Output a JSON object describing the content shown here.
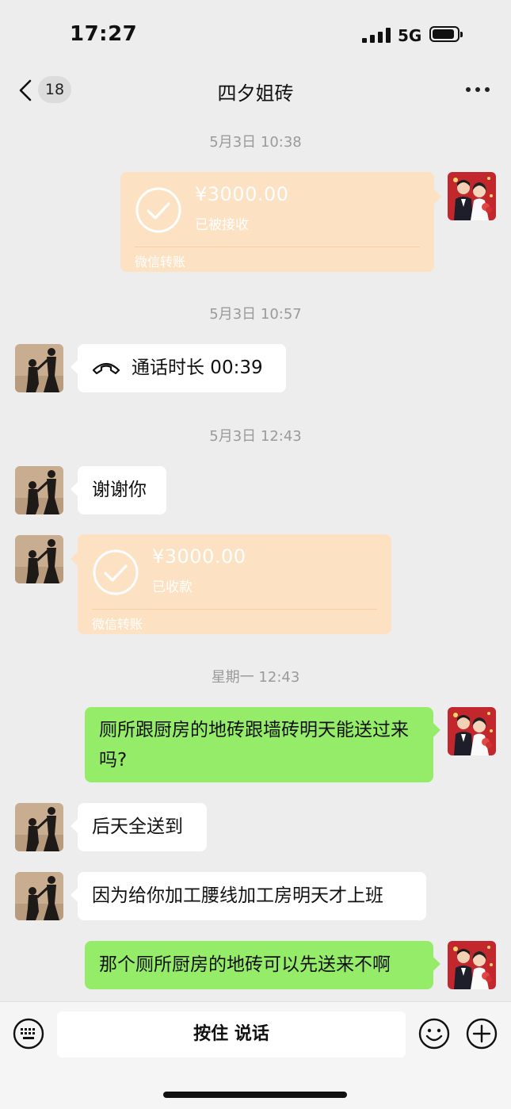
{
  "status_bar": {
    "time": "17:27",
    "network": "5G"
  },
  "nav": {
    "back_badge": "18",
    "title": "四夕姐砖"
  },
  "messages": {
    "t1": "5月3日 10:38",
    "transfer1": {
      "amount": "¥3000.00",
      "status": "已被接收",
      "label": "微信转账"
    },
    "t2": "5月3日 10:57",
    "call": {
      "text": "通话时长 00:39"
    },
    "t3": "5月3日 12:43",
    "thanks": "谢谢你",
    "transfer2": {
      "amount": "¥3000.00",
      "status": "已收款",
      "label": "微信转账"
    },
    "t4": "星期一 12:43",
    "q1": "厕所跟厨房的地砖跟墙砖明天能送过来吗?",
    "a1": "后天全送到",
    "a2": "因为给你加工腰线加工房明天才上班",
    "q2": "那个厕所厨房的地砖可以先送来不啊"
  },
  "input_bar": {
    "voice_label": "按住 说话"
  },
  "colors": {
    "green_bubble": "#95ec69",
    "transfer_bg": "#fde1c3",
    "bg": "#ededed"
  }
}
